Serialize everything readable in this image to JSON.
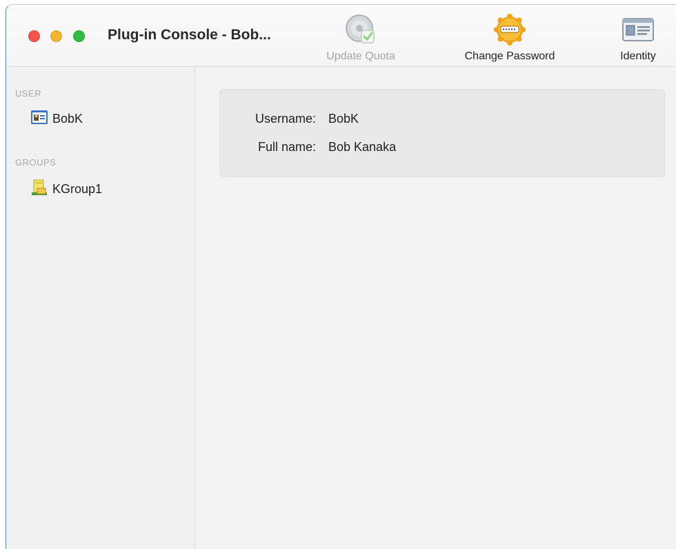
{
  "window": {
    "title": "Plug-in Console - Bob..."
  },
  "toolbar": {
    "update_quota": {
      "label": "Update Quota",
      "icon": "update-quota-icon",
      "enabled": false
    },
    "change_password": {
      "label": "Change Password",
      "icon": "password-badge-icon",
      "enabled": true
    },
    "identity": {
      "label": "Identity",
      "icon": "id-card-icon",
      "enabled": true
    }
  },
  "sidebar": {
    "user_section": "USER",
    "user": {
      "label": "BobK",
      "icon": "user-card-icon"
    },
    "groups_section": "GROUPS",
    "groups": [
      {
        "label": "KGroup1",
        "icon": "group-folder-icon"
      }
    ]
  },
  "details": {
    "username_label": "Username:",
    "username_value": "BobK",
    "fullname_label": "Full name:",
    "fullname_value": "Bob Kanaka"
  },
  "colors": {
    "close": "#f0554e",
    "minimize": "#f5b331",
    "zoom": "#2fbd46"
  }
}
